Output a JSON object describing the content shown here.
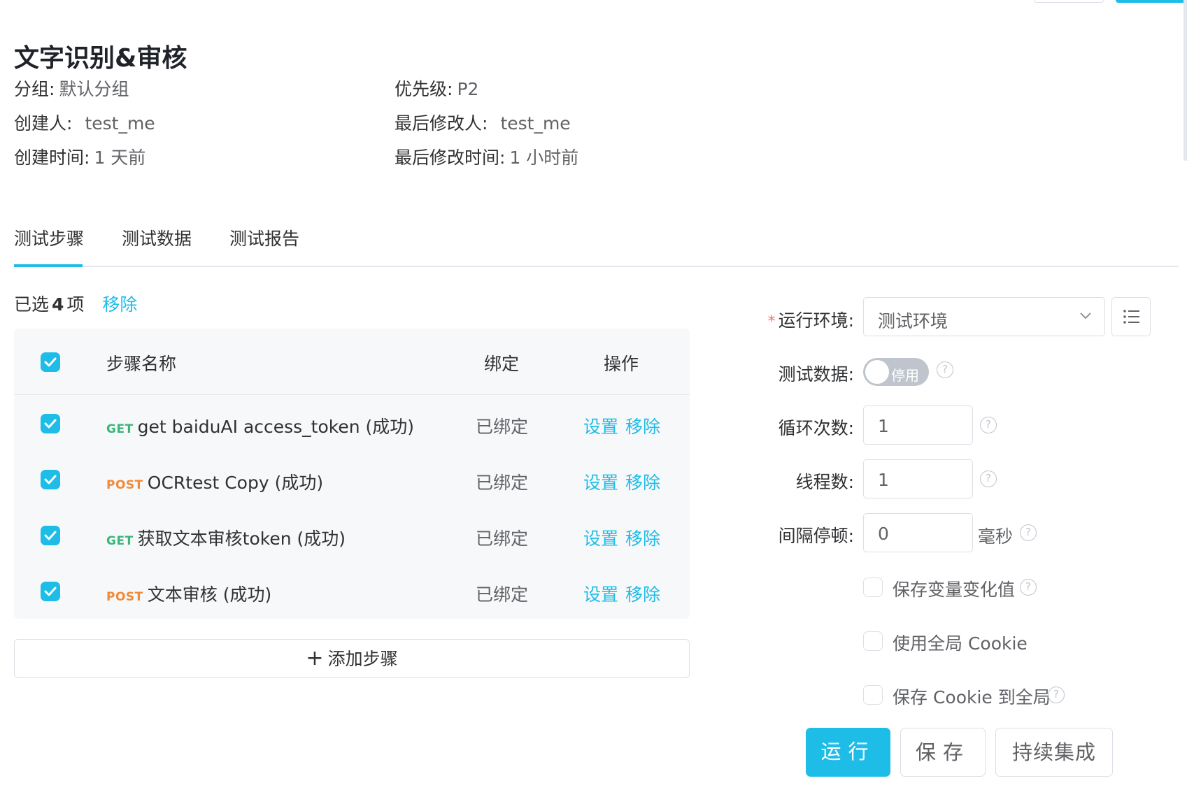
{
  "header": {
    "title": "文字识别&审核",
    "group_label": "分组:",
    "group_value": "默认分组",
    "priority_label": "优先级:",
    "priority_value": "P2",
    "creator_label": "创建人:",
    "creator_value": "test_me",
    "modifier_label": "最后修改人:",
    "modifier_value": "test_me",
    "created_label": "创建时间:",
    "created_value": "1 天前",
    "modified_label": "最后修改时间:",
    "modified_value": "1 小时前"
  },
  "tabs": [
    {
      "label": "测试步骤",
      "active": true
    },
    {
      "label": "测试数据",
      "active": false
    },
    {
      "label": "测试报告",
      "active": false
    }
  ],
  "selection": {
    "prefix": "已选",
    "count": "4",
    "suffix": "项",
    "remove_label": "移除"
  },
  "table": {
    "headers": {
      "name": "步骤名称",
      "bind": "绑定",
      "ops": "操作"
    },
    "rows": [
      {
        "method": "GET",
        "name": "get baiduAI access_token (成功)",
        "bind": "已绑定",
        "set": "设置",
        "remove": "移除"
      },
      {
        "method": "POST",
        "name": "OCRtest Copy (成功)",
        "bind": "已绑定",
        "set": "设置",
        "remove": "移除"
      },
      {
        "method": "GET",
        "name": "获取文本审核token (成功)",
        "bind": "已绑定",
        "set": "设置",
        "remove": "移除"
      },
      {
        "method": "POST",
        "name": "文本审核 (成功)",
        "bind": "已绑定",
        "set": "设置",
        "remove": "移除"
      }
    ]
  },
  "add_step_label": "添加步骤",
  "add_step_plus": "+",
  "form": {
    "env_label": "运行环境:",
    "env_required_mark": "*",
    "env_value": "测试环境",
    "test_data_label": "测试数据:",
    "test_data_switch": "停用",
    "loop_label": "循环次数:",
    "loop_value": "1",
    "threads_label": "线程数:",
    "threads_value": "1",
    "interval_label": "间隔停顿:",
    "interval_value": "0",
    "interval_unit": "毫秒",
    "help_glyph": "?",
    "save_vars_label": "保存变量变化值",
    "global_cookie_label": "使用全局 Cookie",
    "save_cookie_label": "保存 Cookie 到全局"
  },
  "buttons": {
    "run": "运行",
    "save": "保存",
    "ci": "持续集成"
  },
  "colors": {
    "primary": "#1ebde8",
    "get": "#3bb57c",
    "post": "#f08a3a",
    "required": "#f56c6c"
  }
}
